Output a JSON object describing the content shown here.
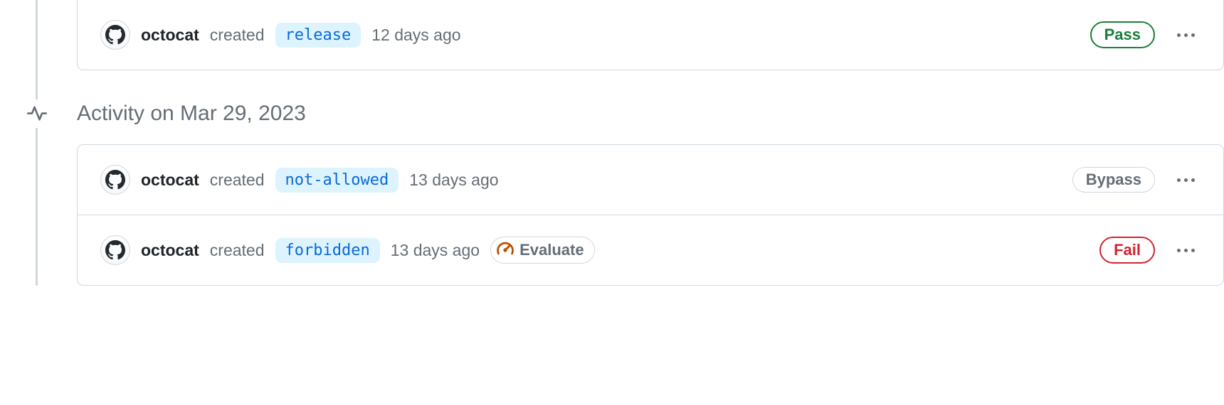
{
  "date_header": "Activity on Mar 29, 2023",
  "top_row": {
    "username": "octocat",
    "action": "created",
    "branch": "release",
    "timestamp": "12 days ago",
    "status": "Pass"
  },
  "rows": [
    {
      "username": "octocat",
      "action": "created",
      "branch": "not-allowed",
      "timestamp": "13 days ago",
      "status": "Bypass"
    },
    {
      "username": "octocat",
      "action": "created",
      "branch": "forbidden",
      "timestamp": "13 days ago",
      "evaluate": "Evaluate",
      "status": "Fail"
    }
  ],
  "colors": {
    "pass": "#1a7f37",
    "bypass": "#656d76",
    "fail": "#d1242f",
    "branch_bg": "#ddf4ff",
    "branch_fg": "#0969da",
    "border": "#d0d7de"
  }
}
